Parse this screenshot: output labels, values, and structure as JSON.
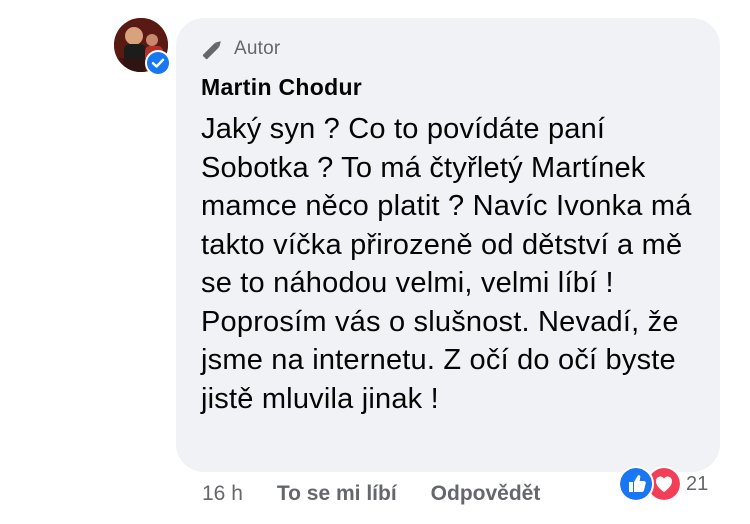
{
  "comment": {
    "author_badge": "Autor",
    "author_name": "Martin Chodur",
    "text": "Jaký syn ? Co to povídáte paní Sobotka ? To má čtyřletý Martínek mamce něco platit ? Navíc Ivonka má takto víčka přirozeně od dětství a mě se to náhodou velmi, velmi líbí ! Poprosím vás o slušnost. Nevadí, že jsme na internetu. Z očí do očí byste jistě mluvila jinak !",
    "timestamp": "16 h",
    "like_label": "To se mi líbí",
    "reply_label": "Odpovědět",
    "reaction_count": "21",
    "icons": {
      "avatar": "profile-photo",
      "verified": "verified-check-icon",
      "badge": "pencil-icon",
      "reactions": [
        "like-icon",
        "love-icon"
      ]
    }
  },
  "colors": {
    "bubble": "#f0f2f5",
    "text": "#050505",
    "meta": "#65676b",
    "like_blue": "#1877f2",
    "love_red": "#f33e58"
  }
}
